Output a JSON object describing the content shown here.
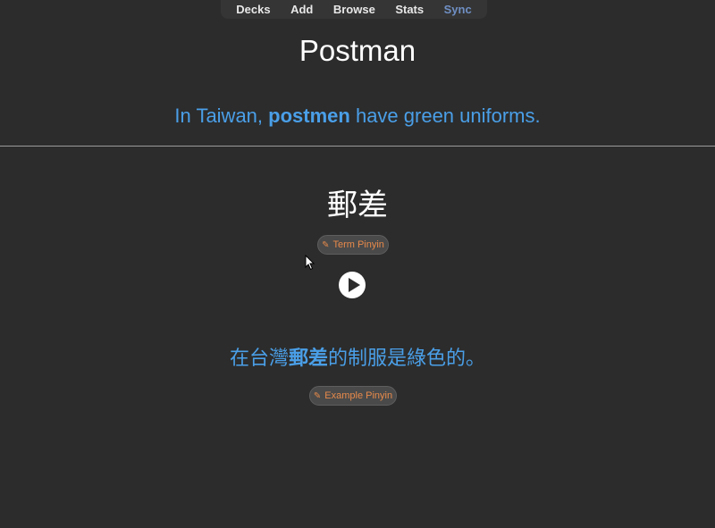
{
  "nav": {
    "items": [
      "Decks",
      "Add",
      "Browse",
      "Stats",
      "Sync"
    ]
  },
  "card": {
    "front": {
      "title": "Postman",
      "sentence_pre": "In Taiwan, ",
      "sentence_bold": "postmen",
      "sentence_post": " have green uniforms."
    },
    "back": {
      "term": "郵差",
      "term_pinyin_label": "Term Pinyin",
      "example_pre": "在台灣",
      "example_bold": "郵差",
      "example_post": "的制服是綠色的。",
      "example_pinyin_label": "Example Pinyin"
    }
  },
  "colors": {
    "background": "#2c2c2c",
    "nav_bg": "#353535",
    "sync_text": "#6f8fc4",
    "accent_blue": "#4a9fe8",
    "pinyin_orange": "#e88a4a",
    "divider": "#9a9a9a"
  },
  "icons": {
    "pinyin_button": "pen-icon",
    "audio": "play-icon",
    "pointer": "mouse-cursor-icon"
  }
}
